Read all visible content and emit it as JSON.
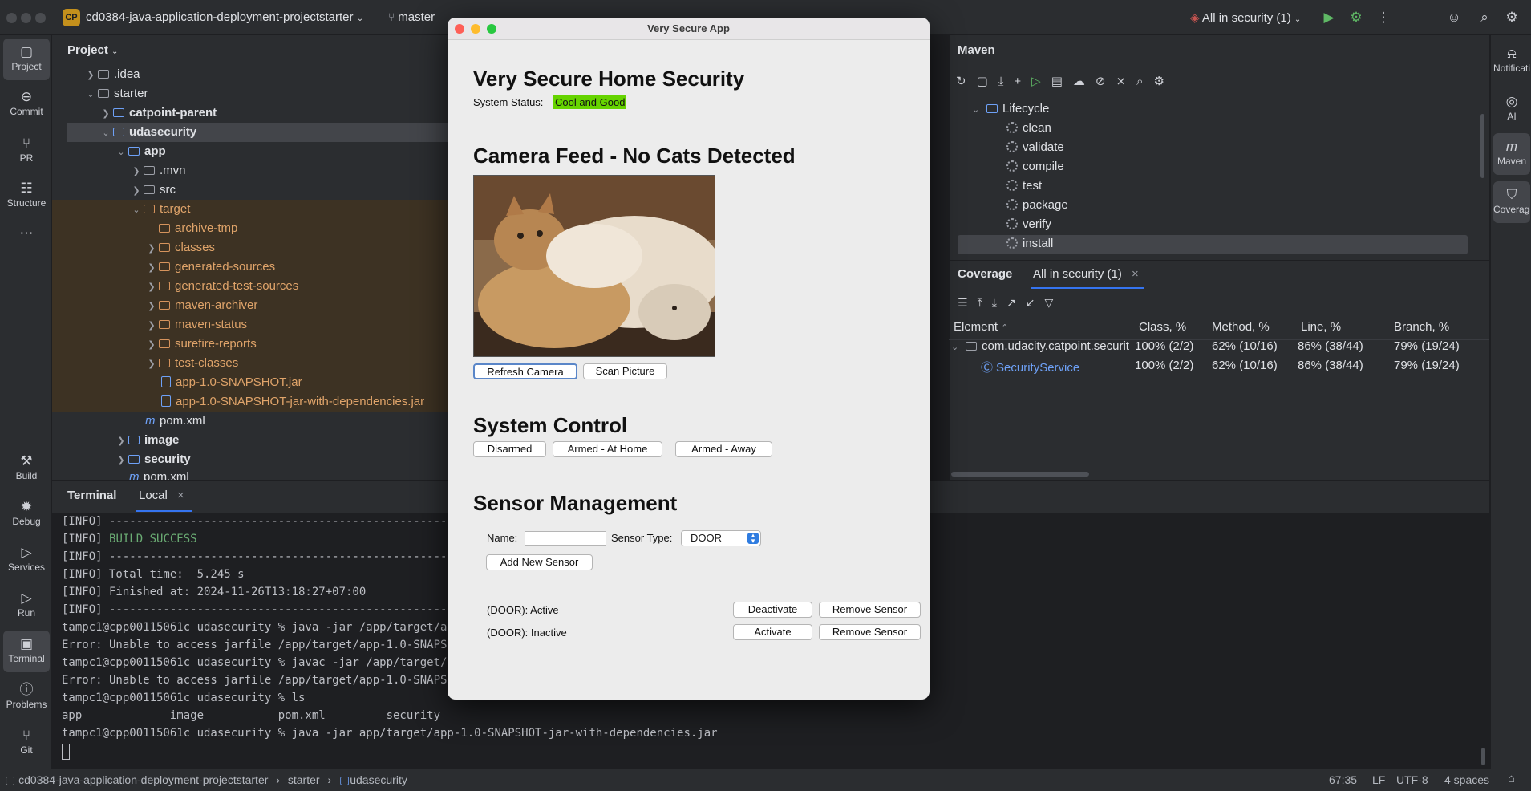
{
  "titlebar": {
    "project_badge": "CP",
    "project_name": "cd0384-java-application-deployment-projectstarter",
    "branch": "master",
    "run_config": "All in security (1)"
  },
  "left_toolbar": {
    "items": [
      {
        "label": "Project",
        "icon": "folder-icon"
      },
      {
        "label": "Commit",
        "icon": "commit-icon"
      },
      {
        "label": "PR",
        "icon": "pull-request-icon"
      },
      {
        "label": "Structure",
        "icon": "structure-icon"
      },
      {
        "label": "Build",
        "icon": "hammer-icon"
      },
      {
        "label": "Debug",
        "icon": "bug-icon"
      },
      {
        "label": "Services",
        "icon": "services-icon"
      },
      {
        "label": "Run",
        "icon": "play-icon"
      },
      {
        "label": "Terminal",
        "icon": "terminal-icon"
      },
      {
        "label": "Problems",
        "icon": "warning-icon"
      },
      {
        "label": "Git",
        "icon": "git-icon"
      }
    ]
  },
  "project": {
    "header": "Project",
    "tree": [
      ".idea",
      "starter",
      "catpoint-parent",
      "udasecurity",
      "app",
      ".mvn",
      "src",
      "target",
      "archive-tmp",
      "classes",
      "generated-sources",
      "generated-test-sources",
      "maven-archiver",
      "maven-status",
      "surefire-reports",
      "test-classes",
      "app-1.0-SNAPSHOT.jar",
      "app-1.0-SNAPSHOT-jar-with-dependencies.jar",
      "pom.xml",
      "image",
      "security",
      "pom.xml"
    ]
  },
  "maven": {
    "title": "Maven",
    "lifecycle": "Lifecycle",
    "goals": [
      "clean",
      "validate",
      "compile",
      "test",
      "package",
      "verify",
      "install"
    ]
  },
  "coverage": {
    "tab": "Coverage",
    "run_tab": "All in security (1)",
    "headers": [
      "Element",
      "Class, %",
      "Method, %",
      "Line, %",
      "Branch, %"
    ],
    "rows": [
      {
        "element": "com.udacity.catpoint.securit",
        "class": "100% (2/2)",
        "method": "62% (10/16)",
        "line": "86% (38/44)",
        "branch": "79% (19/24)"
      },
      {
        "element": "SecurityService",
        "class": "100% (2/2)",
        "method": "62% (10/16)",
        "line": "86% (38/44)",
        "branch": "79% (19/24)"
      }
    ]
  },
  "right_toolbar": {
    "items": [
      {
        "label": "Notifications",
        "icon": "bell-icon"
      },
      {
        "label": "AI",
        "icon": "ai-icon"
      },
      {
        "label": "Maven",
        "icon": "maven-icon"
      },
      {
        "label": "Coverage",
        "icon": "shield-icon"
      }
    ]
  },
  "terminal": {
    "tab": "Terminal",
    "local_tab": "Local",
    "lines": [
      "[INFO] -----------------------------------------------------------------------",
      "[INFO] BUILD SUCCESS",
      "[INFO] -----------------------------------------------------------------------",
      "[INFO] Total time:  5.245 s",
      "[INFO] Finished at: 2024-11-26T13:18:27+07:00",
      "[INFO] -----------------------------------------------------------------------",
      "tampc1@cpp00115061c udasecurity % java -jar /app/target/app-",
      "Error: Unable to access jarfile /app/target/app-1.0-SNAPSHOT",
      "tampc1@cpp00115061c udasecurity % javac -jar /app/target/app",
      "Error: Unable to access jarfile /app/target/app-1.0-SNAPSHOT",
      "tampc1@cpp00115061c udasecurity % ls",
      "app             image           pom.xml         security",
      "tampc1@cpp00115061c udasecurity % java -jar app/target/app-1.0-SNAPSHOT-jar-with-dependencies.jar"
    ]
  },
  "statusbar": {
    "crumbs": [
      "cd0384-java-application-deployment-projectstarter",
      "starter",
      "udasecurity"
    ],
    "position": "67:35",
    "line_sep": "LF",
    "encoding": "UTF-8",
    "indent": "4 spaces"
  },
  "app": {
    "window_title": "Very Secure App",
    "title": "Very Secure Home Security",
    "status_label": "System Status:",
    "status_value": "Cool and Good",
    "status_color": "#66d400",
    "camera_heading": "Camera Feed - No Cats Detected",
    "refresh_camera": "Refresh Camera",
    "scan_picture": "Scan Picture",
    "control_heading": "System Control",
    "disarmed": "Disarmed",
    "armed_home": "Armed - At Home",
    "armed_away": "Armed - Away",
    "sensor_heading": "Sensor Management",
    "name_label": "Name:",
    "name_value": "",
    "sensor_type_label": "Sensor Type:",
    "sensor_type_value": "DOOR",
    "add_sensor": "Add New Sensor",
    "sensors": [
      {
        "label": "(DOOR): Active",
        "toggle": "Deactivate",
        "remove": "Remove Sensor"
      },
      {
        "label": "(DOOR): Inactive",
        "toggle": "Activate",
        "remove": "Remove Sensor"
      }
    ]
  }
}
